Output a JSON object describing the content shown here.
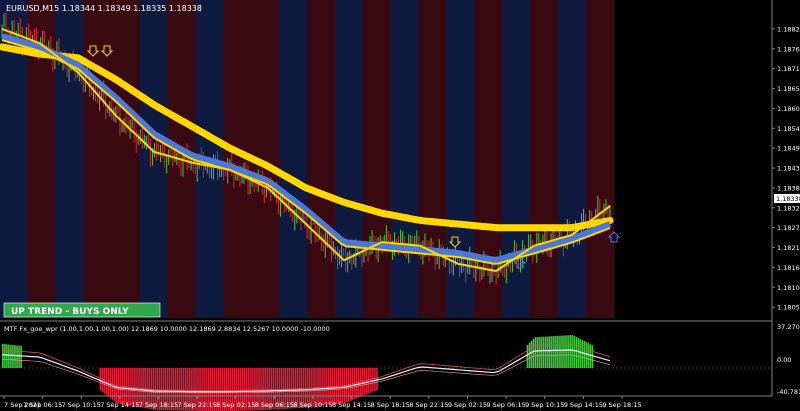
{
  "window": {
    "title": "EURUSD,M15",
    "ohlc": "1.18344 1.18349 1.18335 1.18338",
    "current_price": "1.18338"
  },
  "price_axis": [
    "1.18820",
    "1.18765",
    "1.18710",
    "1.18655",
    "1.18600",
    "1.18545",
    "1.18490",
    "1.18435",
    "1.18380",
    "1.18325",
    "1.18270",
    "1.18215",
    "1.18160",
    "1.18105",
    "1.18050"
  ],
  "time_axis": [
    "7 Sep 2021",
    "7 Sep 06:15",
    "7 Sep 10:15",
    "7 Sep 14:15",
    "7 Sep 18:15",
    "7 Sep 22:15",
    "8 Sep 02:15",
    "8 Sep 06:15",
    "8 Sep 10:15",
    "8 Sep 14:15",
    "8 Sep 18:15",
    "8 Sep 22:15",
    "9 Sep 02:15",
    "9 Sep 06:15",
    "9 Sep 10:15",
    "9 Sep 14:15",
    "9 Sep 18:15"
  ],
  "trend_banner": "UP TREND - BUYS ONLY",
  "indicator": {
    "label": "MTF Fx_goe_wpr (1.00,1.00,1.00,1.00) 12.1869 10.0000 12.1869 2.8834 12.5267 10.0000 -10.0000",
    "axis": [
      "37.2709",
      "0.00",
      "-40.7811"
    ]
  },
  "colors": {
    "bg": "#000000",
    "band_red": "#3a0a12",
    "band_blue": "#0f1a40",
    "bull": "#3ccc3c",
    "bear": "#e0203a",
    "neutral": "#8a8a8a",
    "ma_slow": "#ffd700",
    "ma_fast": "#4a78d8",
    "banner": "#2ea84a",
    "current_tag": "#ffffff"
  },
  "chart_data": {
    "type": "line",
    "title": "EURUSD,M15",
    "ylim": [
      1.1802,
      1.189
    ],
    "x": [
      "7 Sep 2021",
      "7 Sep 06:15",
      "7 Sep 10:15",
      "7 Sep 14:15",
      "7 Sep 18:15",
      "7 Sep 22:15",
      "8 Sep 02:15",
      "8 Sep 06:15",
      "8 Sep 10:15",
      "8 Sep 14:15",
      "8 Sep 18:15",
      "8 Sep 22:15",
      "9 Sep 02:15",
      "9 Sep 06:15",
      "9 Sep 10:15",
      "9 Sep 14:15",
      "9 Sep 18:15"
    ],
    "series": [
      {
        "values": [
          1.1882,
          1.1878,
          1.187,
          1.1858,
          1.1848,
          1.1845,
          1.1843,
          1.1838,
          1.1828,
          1.1818,
          1.1823,
          1.1822,
          1.1817,
          1.1815,
          1.1822,
          1.1825,
          1.1833
        ]
      },
      {
        "values": [
          1.1877,
          1.1875,
          1.1874,
          1.1868,
          1.1861,
          1.1855,
          1.1849,
          1.1844,
          1.1838,
          1.1834,
          1.1831,
          1.1829,
          1.1828,
          1.1827,
          1.1827,
          1.1827,
          1.1829
        ]
      },
      {
        "values": [
          1.188,
          1.1877,
          1.1872,
          1.1863,
          1.1853,
          1.1847,
          1.1844,
          1.184,
          1.1832,
          1.1823,
          1.1822,
          1.1821,
          1.182,
          1.1818,
          1.1821,
          1.1824,
          1.1828
        ]
      }
    ],
    "indicator_values": [
      22,
      18,
      -5,
      -32,
      -38,
      -39,
      -39,
      -38,
      -36,
      -32,
      -18,
      2,
      -3,
      -8,
      28,
      30,
      12
    ]
  }
}
